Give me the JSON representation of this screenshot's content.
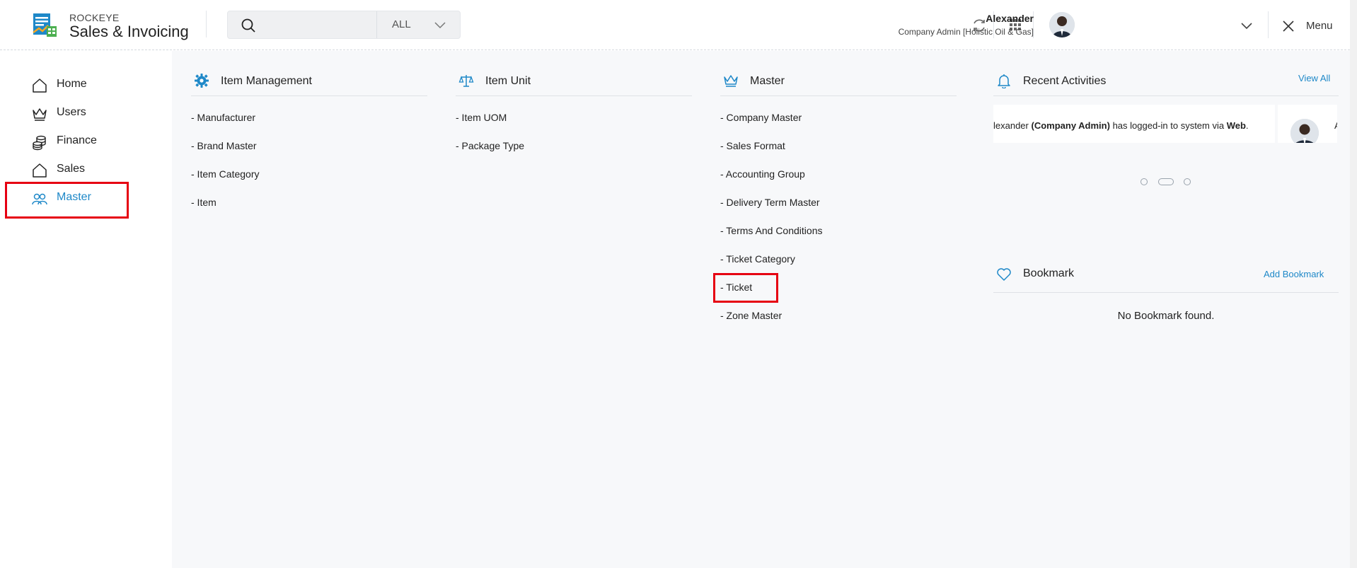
{
  "app": {
    "brand_top": "ROCKEYE",
    "brand_main": "Sales & Invoicing"
  },
  "search": {
    "placeholder": "",
    "filter": "ALL"
  },
  "user": {
    "name": "Alexander",
    "role": "Company Admin [Holistic Oil & Gas]"
  },
  "menu": {
    "label": "Menu"
  },
  "sidebar": {
    "items": [
      {
        "label": "Home",
        "icon": "home-icon"
      },
      {
        "label": "Users",
        "icon": "crown-icon"
      },
      {
        "label": "Finance",
        "icon": "coins-icon"
      },
      {
        "label": "Sales",
        "icon": "home-icon"
      },
      {
        "label": "Master",
        "icon": "users-icon",
        "active": true
      }
    ]
  },
  "sections": {
    "item_management": {
      "title": "Item Management",
      "icon": "gear-icon",
      "links": [
        "- Manufacturer",
        "- Brand Master",
        "- Item Category",
        "- Item"
      ]
    },
    "item_unit": {
      "title": "Item Unit",
      "icon": "scale-icon",
      "links": [
        "- Item UOM",
        "- Package Type"
      ]
    },
    "master": {
      "title": "Master",
      "icon": "crown-icon",
      "links": [
        "- Company Master",
        "- Sales Format",
        "- Accounting Group",
        "- Delivery Term Master",
        "- Terms And Conditions",
        "- Ticket Category",
        "- Ticket",
        "- Zone Master"
      ]
    }
  },
  "recent_activities": {
    "title": "Recent Activities",
    "view_all": "View All",
    "activity_prefix": "lexander ",
    "activity_role": "(Company Admin)",
    "activity_middle": " has logged-in to system via ",
    "activity_channel": "Web",
    "activity_suffix": ".",
    "next_card_initial": "A"
  },
  "bookmark": {
    "title": "Bookmark",
    "add": "Add Bookmark",
    "empty": "No Bookmark found."
  },
  "colors": {
    "accent": "#1e88c8",
    "highlight": "#e60012",
    "panel_bg": "#f7f8fa"
  }
}
